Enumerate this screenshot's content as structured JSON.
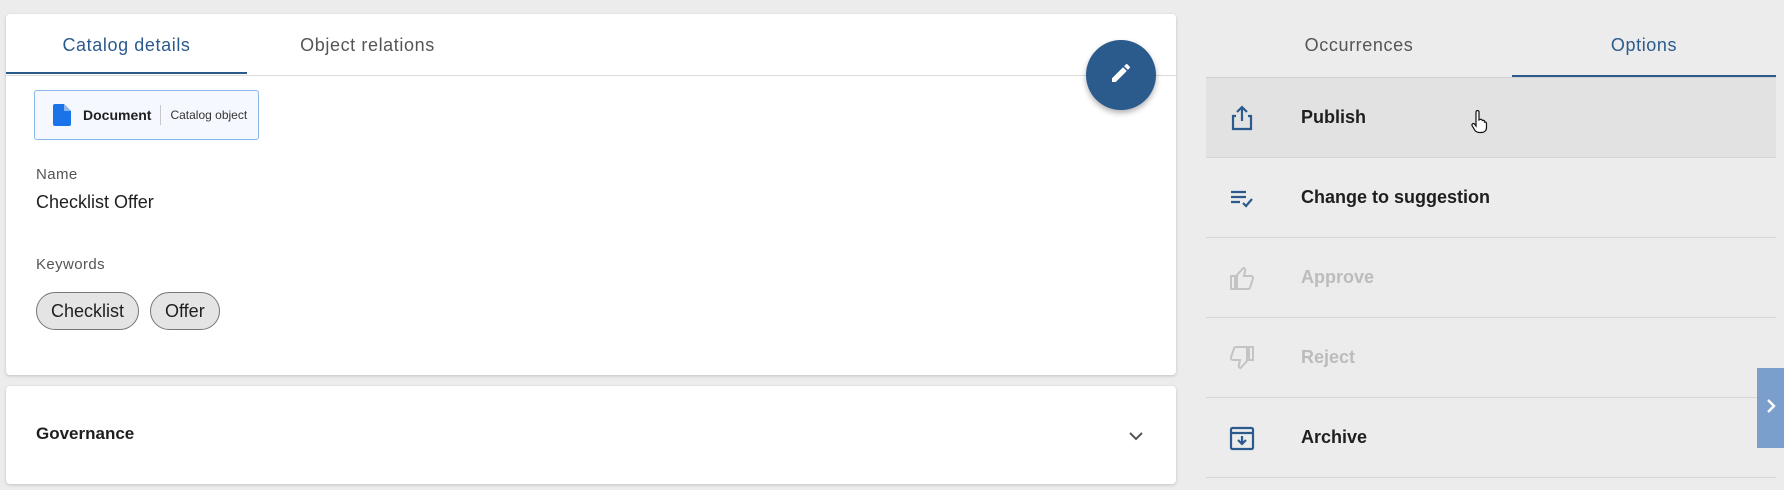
{
  "main": {
    "tabs": [
      {
        "label": "Catalog details",
        "active": true
      },
      {
        "label": "Object relations",
        "active": false
      }
    ],
    "type_chip": {
      "icon": "document-icon",
      "label": "Document",
      "sub": "Catalog object"
    },
    "fields": {
      "name_label": "Name",
      "name_value": "Checklist Offer",
      "keywords_label": "Keywords",
      "keywords": [
        "Checklist",
        "Offer"
      ]
    },
    "fab": {
      "icon": "pencil-icon"
    }
  },
  "governance": {
    "title": "Governance",
    "icon": "chevron-down-icon"
  },
  "right": {
    "tabs": [
      {
        "label": "Occurrences",
        "active": false
      },
      {
        "label": "Options",
        "active": true
      }
    ],
    "options": [
      {
        "label": "Publish",
        "icon": "share-upload-icon",
        "enabled": true,
        "hover": true
      },
      {
        "label": "Change to suggestion",
        "icon": "playlist-check-icon",
        "enabled": true
      },
      {
        "label": "Approve",
        "icon": "thumb-up-icon",
        "enabled": false
      },
      {
        "label": "Reject",
        "icon": "thumb-down-icon",
        "enabled": false
      },
      {
        "label": "Archive",
        "icon": "archive-icon",
        "enabled": true
      }
    ]
  },
  "side_toggle": {
    "icon": "chevron-right-icon"
  },
  "colors": {
    "accent": "#2b5a8d",
    "doc_blue": "#1a73e8",
    "disabled": "#bcbcbc",
    "toggle": "#7a9fcc"
  }
}
